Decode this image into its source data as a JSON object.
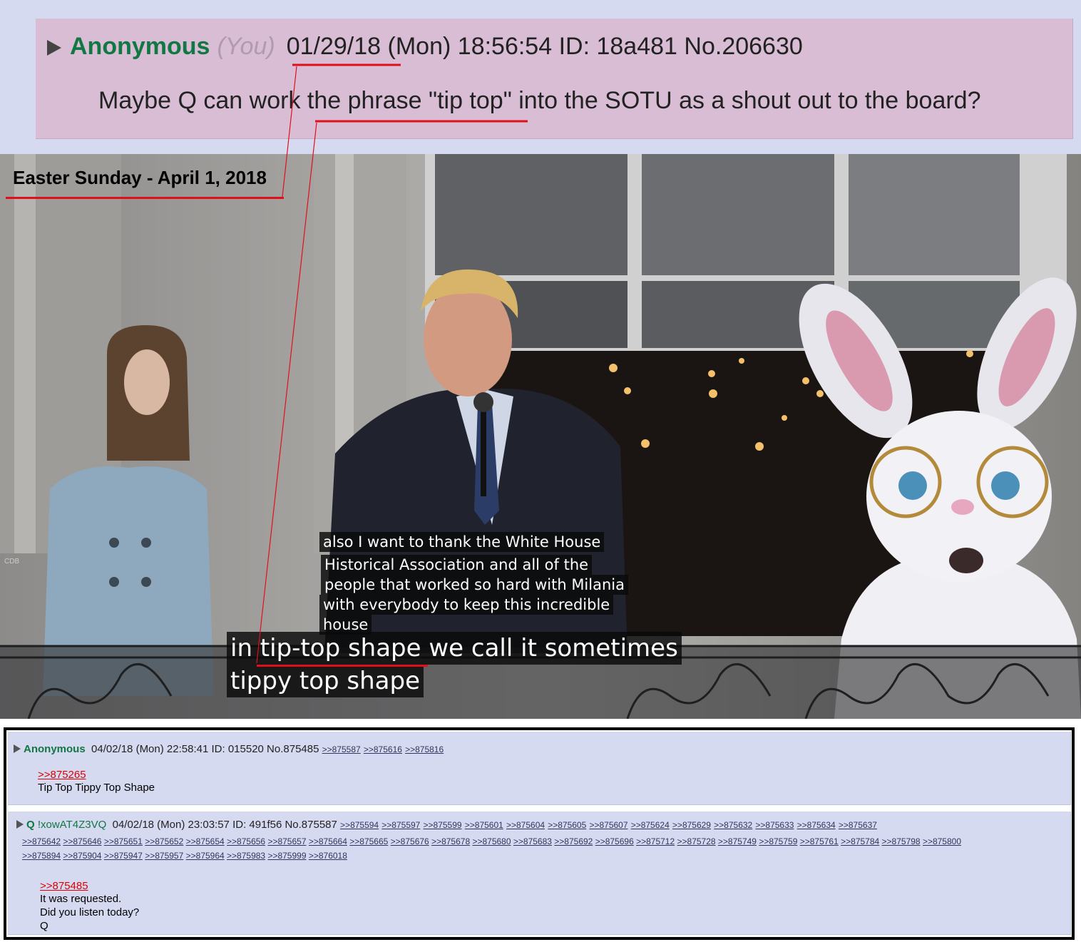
{
  "top_post": {
    "name": "Anonymous",
    "you": "(You)",
    "date": "01/29/18",
    "day": "(Mon)",
    "time": "18:56:54",
    "id": "ID: 18a481",
    "number": "No.206630",
    "message": "Maybe Q can work the phrase \"tip top\" into the SOTU as a shout out to the board?"
  },
  "scene": {
    "title": "Easter Sunday - April 1, 2018",
    "caption_lines": [
      "also I want to thank the White House",
      "Historical Association and all of the",
      "people that worked so hard with Milania",
      "with everybody to keep this incredible",
      "house"
    ],
    "large_caption_lines": [
      "in tip-top shape we call it sometimes",
      "tippy top shape"
    ],
    "watermark": "CDB"
  },
  "post1": {
    "name": "Anonymous",
    "date": "04/02/18 (Mon) 22:58:41",
    "id": "ID: 015520",
    "number": "No.875485",
    "backlinks": [
      ">>875587",
      ">>875616",
      ">>875816"
    ],
    "quote": ">>875265",
    "text": "Tip Top Tippy Top Shape"
  },
  "post2": {
    "name": "Q",
    "trip": "!xowAT4Z3VQ",
    "date": "04/02/18 (Mon) 23:03:57",
    "id": "ID: 491f56",
    "number": "No.875587",
    "backlinks": [
      ">>875594",
      ">>875597",
      ">>875599",
      ">>875601",
      ">>875604",
      ">>875605",
      ">>875607",
      ">>875624",
      ">>875629",
      ">>875632",
      ">>875633",
      ">>875634",
      ">>875637",
      ">>875642",
      ">>875646",
      ">>875651",
      ">>875652",
      ">>875654",
      ">>875656",
      ">>875657",
      ">>875664",
      ">>875665",
      ">>875676",
      ">>875678",
      ">>875680",
      ">>875683",
      ">>875692",
      ">>875696",
      ">>875712",
      ">>875728",
      ">>875749",
      ">>875759",
      ">>875761",
      ">>875784",
      ">>875798",
      ">>875800",
      ">>875894",
      ">>875904",
      ">>875947",
      ">>875957",
      ">>875964",
      ">>875983",
      ">>875999",
      ">>876018"
    ],
    "quote": ">>875485",
    "line1": "It was requested.",
    "line2": "Did you listen today?",
    "line3": "Q"
  },
  "colors": {
    "annotation_red": "#e0101a",
    "name_green": "#117743",
    "post_blue": "#d6daf0",
    "post_pink": "#d8bdd5"
  }
}
